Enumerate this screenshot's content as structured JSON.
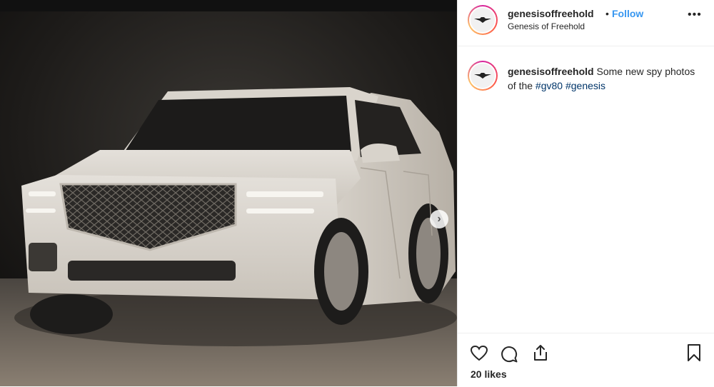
{
  "header": {
    "username": "genesisoffreehold",
    "separator": "•",
    "follow_label": "Follow",
    "location": "Genesis of Freehold",
    "more_label": "•••"
  },
  "caption": {
    "username": "genesisoffreehold",
    "text": "Some new spy photos of the",
    "hashtags": [
      "#gv80",
      "#genesis"
    ]
  },
  "media": {
    "next_label": "›",
    "image_subject": "white SUV"
  },
  "actions": {
    "icons": [
      "heart-icon",
      "comment-icon",
      "share-icon",
      "bookmark-icon"
    ],
    "likes_label": "20 likes"
  },
  "colors": {
    "link": "#3897f0",
    "hashtag": "#003569",
    "text": "#262626"
  }
}
